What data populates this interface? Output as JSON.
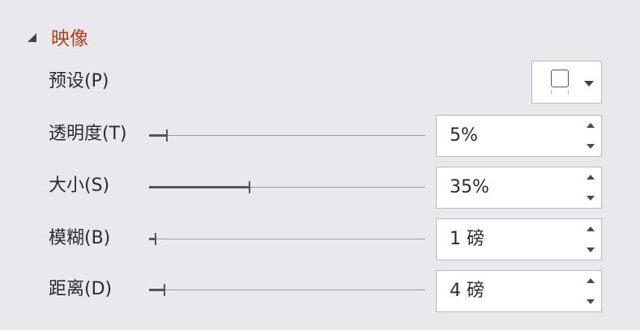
{
  "section": {
    "title": "映像",
    "icon": "collapse-triangle-icon"
  },
  "preset": {
    "label": "预设(P)",
    "icon": "reflection-preset-icon"
  },
  "rows": [
    {
      "label": "透明度(T)",
      "value": "5%",
      "level": 0.05
    },
    {
      "label": "大小(S)",
      "value": "35%",
      "level": 0.35
    },
    {
      "label": "模糊(B)",
      "value": "1 磅",
      "level": 0.01
    },
    {
      "label": "距离(D)",
      "value": "4 磅",
      "level": 0.04
    }
  ],
  "colors": {
    "section_title": "#b0401e",
    "background": "#e9e8ec"
  }
}
